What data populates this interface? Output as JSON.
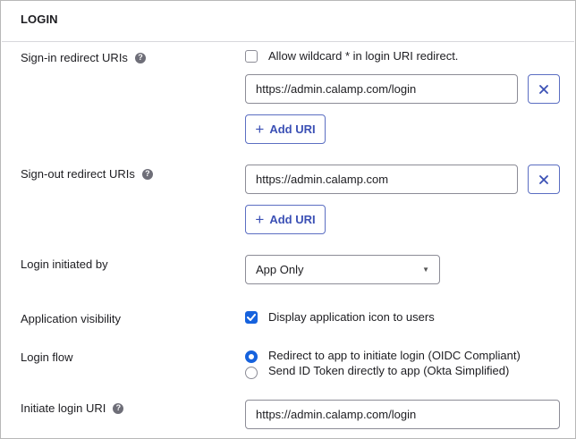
{
  "section": {
    "title": "LOGIN"
  },
  "signin": {
    "label": "Sign-in redirect URIs",
    "wildcard_label": "Allow wildcard * in login URI redirect.",
    "wildcard_checked": false,
    "uri": "https://admin.calamp.com/login",
    "add_label": "Add URI"
  },
  "signout": {
    "label": "Sign-out redirect URIs",
    "uri": "https://admin.calamp.com",
    "add_label": "Add URI"
  },
  "initiated_by": {
    "label": "Login initiated by",
    "selected": "App Only"
  },
  "visibility": {
    "label": "Application visibility",
    "option_label": "Display application icon to users",
    "checked": true
  },
  "login_flow": {
    "label": "Login flow",
    "options": [
      {
        "label": "Redirect to app to initiate login (OIDC Compliant)",
        "selected": true
      },
      {
        "label": "Send ID Token directly to app (Okta Simplified)",
        "selected": false
      }
    ]
  },
  "initiate_uri": {
    "label": "Initiate login URI",
    "value": "https://admin.calamp.com/login"
  },
  "icons": {
    "help": "question-circle-icon",
    "remove": "close-icon",
    "add": "plus-icon",
    "dropdown": "caret-down-icon",
    "check": "checkmark-icon"
  },
  "colors": {
    "accent": "#1662dd",
    "button_border": "#5b6ec2",
    "button_text": "#3b50b5"
  }
}
